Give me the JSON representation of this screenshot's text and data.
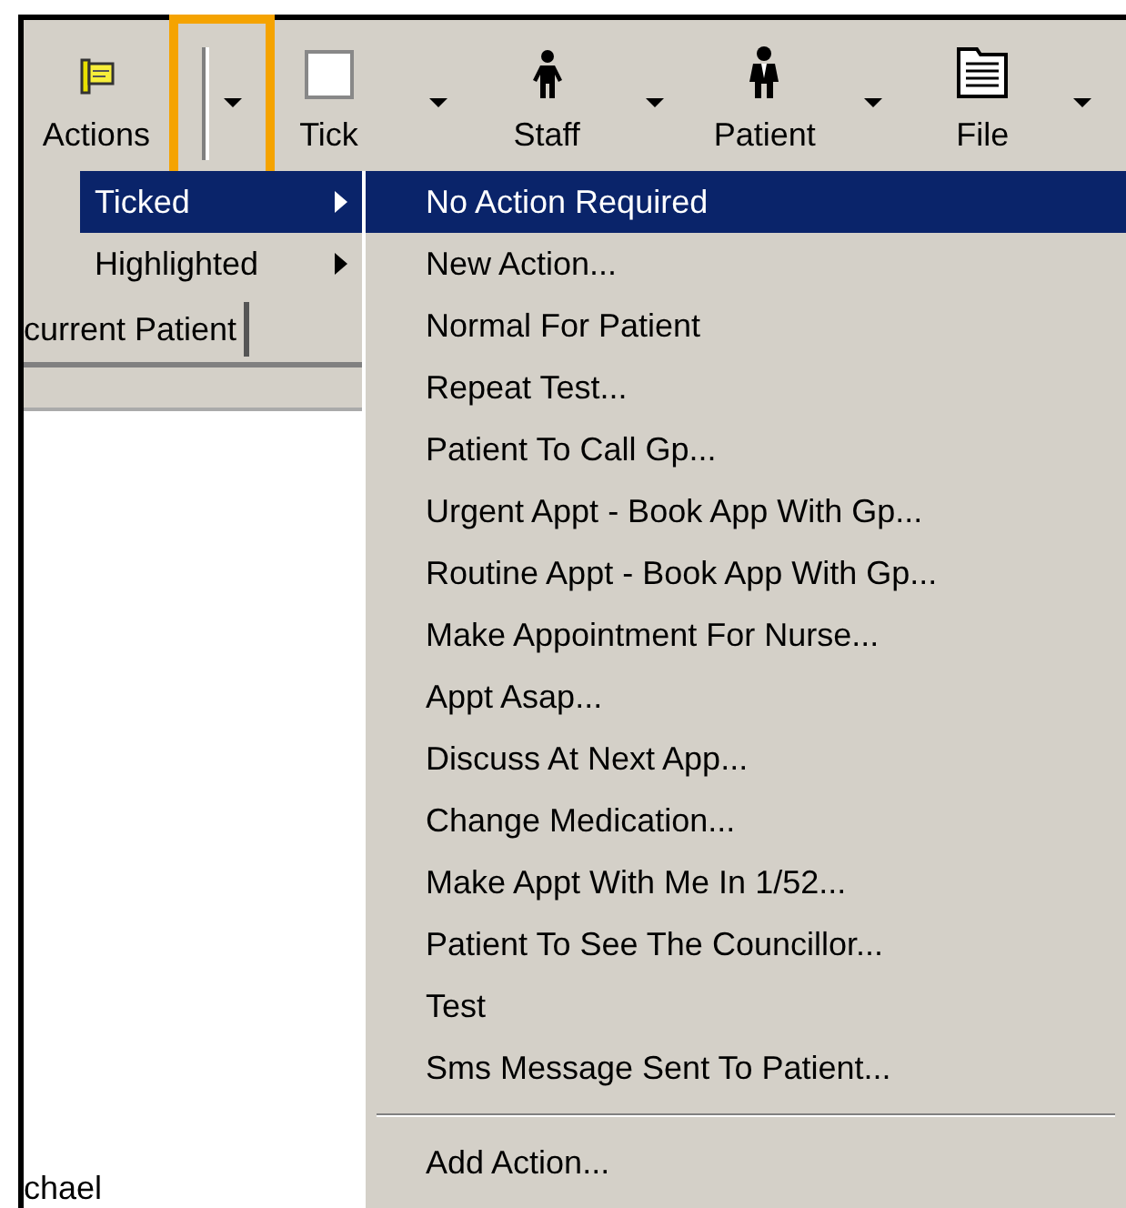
{
  "toolbar": {
    "buttons": [
      {
        "label": "Actions",
        "kind": "flag",
        "dropdown_highlighted": true
      },
      {
        "label": "Tick",
        "kind": "checkbox",
        "dropdown_highlighted": false
      },
      {
        "label": "Staff",
        "kind": "person",
        "dropdown_highlighted": false
      },
      {
        "label": "Patient",
        "kind": "suited-person",
        "dropdown_highlighted": false
      },
      {
        "label": "File",
        "kind": "document",
        "dropdown_highlighted": false
      }
    ]
  },
  "submenu": {
    "items": [
      {
        "label": "Ticked",
        "selected": true
      },
      {
        "label": "Highlighted",
        "selected": false
      }
    ]
  },
  "tab": {
    "label": "current Patient"
  },
  "footer_text": "chael",
  "action_menu": {
    "items": [
      {
        "kind": "item",
        "label": "No Action Required",
        "selected": true
      },
      {
        "kind": "item",
        "label": "New Action...",
        "selected": false
      },
      {
        "kind": "item",
        "label": "Normal For Patient",
        "selected": false
      },
      {
        "kind": "item",
        "label": "Repeat Test...",
        "selected": false
      },
      {
        "kind": "item",
        "label": "Patient To Call Gp...",
        "selected": false
      },
      {
        "kind": "item",
        "label": "Urgent Appt - Book App With Gp...",
        "selected": false
      },
      {
        "kind": "item",
        "label": "Routine Appt - Book App With Gp...",
        "selected": false
      },
      {
        "kind": "item",
        "label": "Make Appointment For Nurse...",
        "selected": false
      },
      {
        "kind": "item",
        "label": "Appt Asap...",
        "selected": false
      },
      {
        "kind": "item",
        "label": "Discuss At Next App...",
        "selected": false
      },
      {
        "kind": "item",
        "label": "Change Medication...",
        "selected": false
      },
      {
        "kind": "item",
        "label": "Make Appt With Me In 1/52...",
        "selected": false
      },
      {
        "kind": "item",
        "label": "Patient To See The Councillor...",
        "selected": false
      },
      {
        "kind": "item",
        "label": "Test",
        "selected": false
      },
      {
        "kind": "item",
        "label": "Sms Message Sent To Patient...",
        "selected": false
      },
      {
        "kind": "separator"
      },
      {
        "kind": "item",
        "label": "Add Action...",
        "selected": false
      }
    ]
  }
}
